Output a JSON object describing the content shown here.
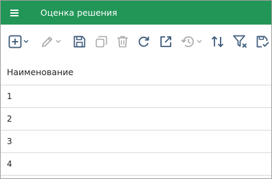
{
  "header": {
    "menu_icon": "hamburger-menu-icon",
    "title": "Оценка решения",
    "background": "#229657"
  },
  "toolbar": {
    "icons": [
      "add-icon",
      "edit-icon",
      "save-icon",
      "copy-icon",
      "delete-icon",
      "refresh-icon",
      "open-external-icon",
      "history-icon",
      "sort-icon",
      "clear-filter-icon",
      "save-check-icon"
    ],
    "active_color": "#3c5a7a",
    "disabled_color": "#a9a9a9"
  },
  "table": {
    "column_header": "Наименование",
    "rows": [
      "1",
      "2",
      "3",
      "4"
    ]
  }
}
